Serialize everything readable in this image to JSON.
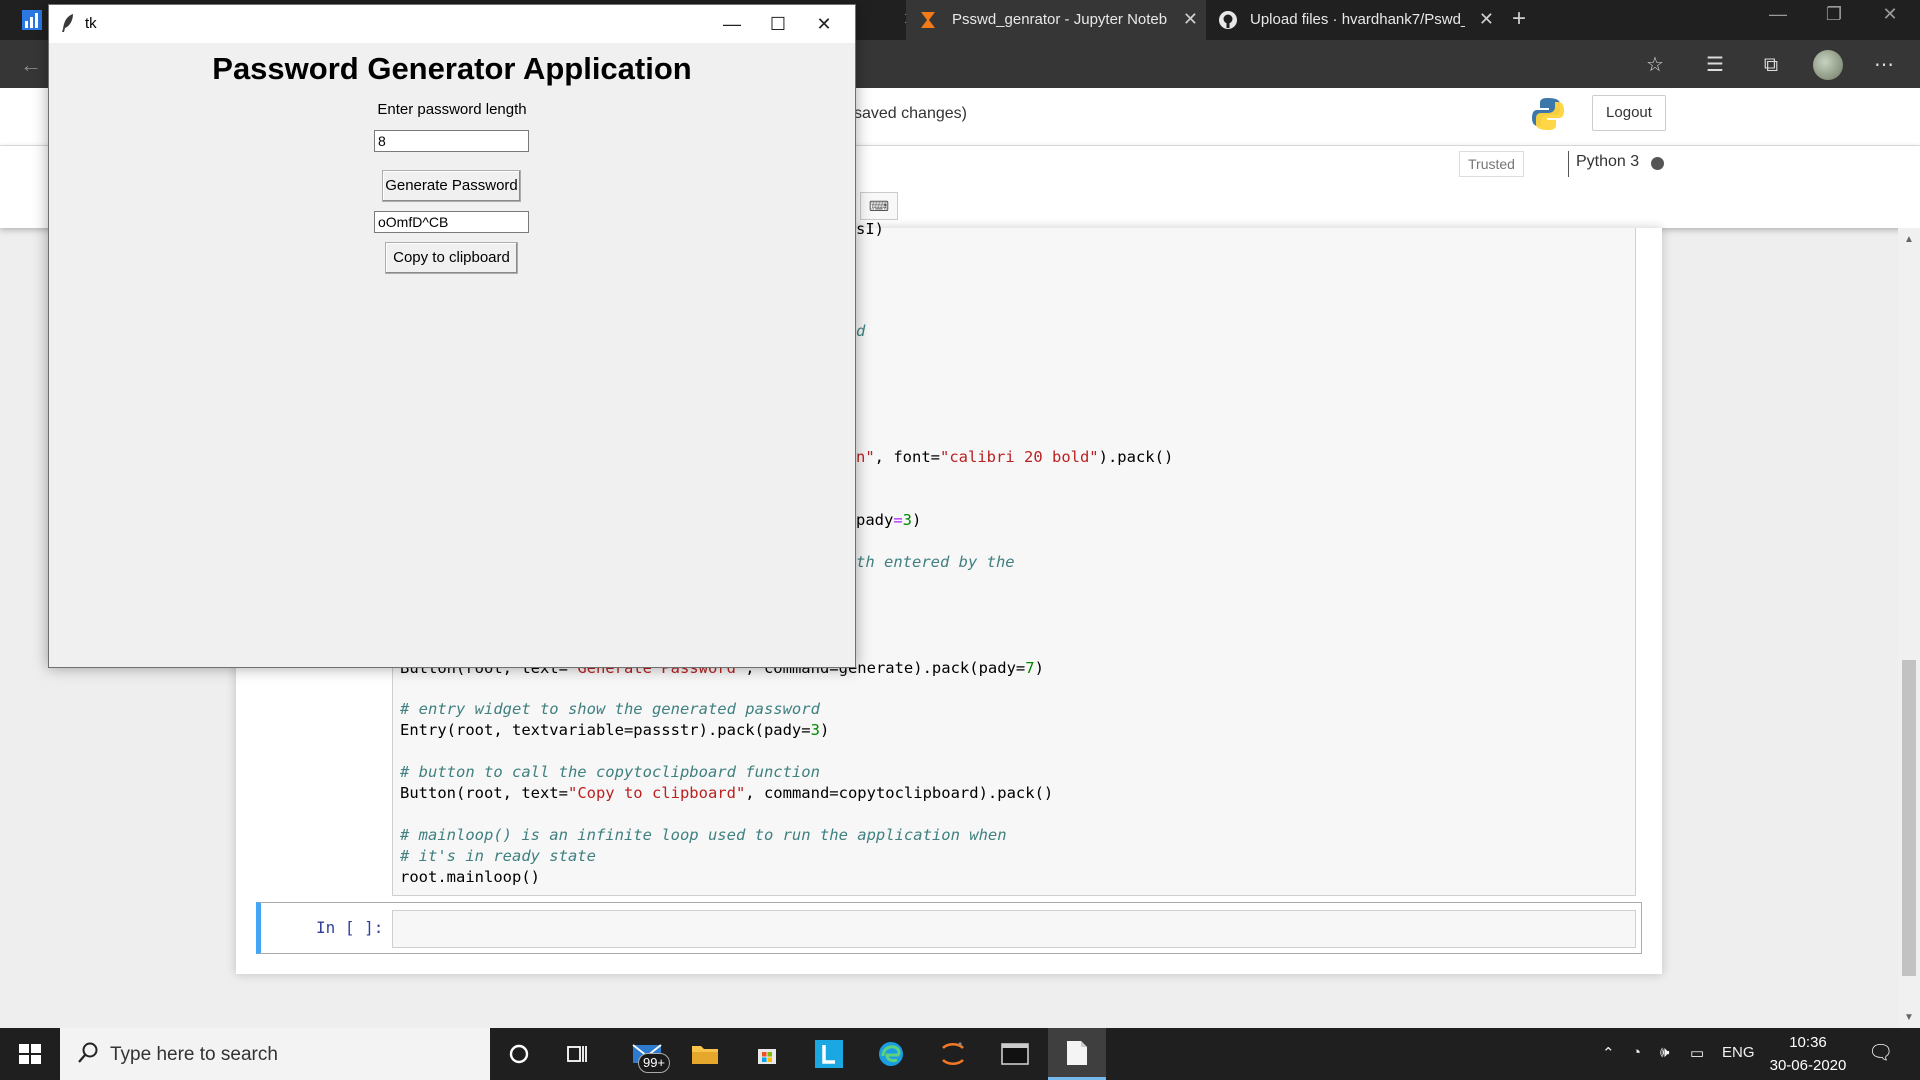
{
  "browser": {
    "tabs": [
      {
        "label": "",
        "active": false
      },
      {
        "label": "Psswd_genrator - Jupyter Noteb",
        "active": true
      },
      {
        "label": "Upload files · hvardhank7/Pswd_",
        "active": false
      }
    ],
    "new_tab_label": "+"
  },
  "jupyter": {
    "save_status": "saved changes)",
    "logout_label": "Logout",
    "trusted_label": "Trusted",
    "kernel_name": "Python 3",
    "next_cell_prompt": "In [ ]:"
  },
  "code": {
    "line_a": "sI)",
    "line_b": "d",
    "line_c_1": "n\"",
    "line_c_2": ", font=",
    "line_c_3": "\"calibri 20 bold\"",
    "line_c_4": ").pack()",
    "line_d_1": "pady",
    "line_d_2": "=",
    "line_d_3": "3",
    "line_d_4": ")",
    "line_e": "th entered by the",
    "line_f_1": "Button(root, text=",
    "line_f_2": "\"Generate Password\"",
    "line_f_3": ", command=generate).pack(pady=",
    "line_f_4": "7",
    "line_f_5": ")",
    "line_g": "# entry widget to show the generated password",
    "line_h_1": "Entry(root, textvariable=passstr).pack(pady=",
    "line_h_2": "3",
    "line_h_3": ")",
    "line_i": "# button to call the copytoclipboard function",
    "line_j_1": "Button(root, text=",
    "line_j_2": "\"Copy to clipboard\"",
    "line_j_3": ", command=copytoclipboard).pack()",
    "line_k": "# mainloop() is an infinite loop used to run the application when",
    "line_l": "# it's in ready state",
    "line_m": "root.mainloop()"
  },
  "tk_app": {
    "window_title": "tk",
    "heading": "Password Generator Application",
    "length_label": "Enter password length",
    "length_value": "8",
    "generate_label": "Generate Password",
    "password_value": "oOmfD^CB",
    "copy_label": "Copy to clipboard"
  },
  "taskbar": {
    "search_placeholder": "Type here to search",
    "mail_badge": "99+",
    "language": "ENG",
    "time": "10:36",
    "date": "30-06-2020"
  },
  "colors": {
    "jupyter_selected_cell": "#42a5f5",
    "taskbar_bg": "#1f1f1f",
    "browser_tabbar": "#202020"
  }
}
